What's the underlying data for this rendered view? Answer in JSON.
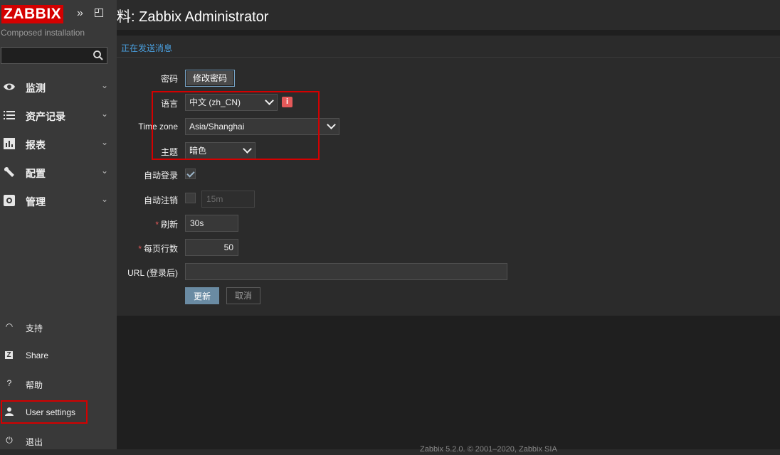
{
  "sidebar": {
    "logo": "ZABBIX",
    "installation": "Composed installation",
    "search": {
      "value": ""
    },
    "menu": [
      {
        "label": "监测",
        "icon": "eye-icon"
      },
      {
        "label": "资产记录",
        "icon": "list-icon"
      },
      {
        "label": "报表",
        "icon": "bar-chart-icon"
      },
      {
        "label": "配置",
        "icon": "wrench-icon"
      },
      {
        "label": "管理",
        "icon": "gear-icon"
      }
    ],
    "bottom": [
      {
        "label": "支持",
        "icon": "headset-icon"
      },
      {
        "label": "Share",
        "icon": "share-icon"
      },
      {
        "label": "帮助",
        "icon": "help-icon"
      },
      {
        "label": "User settings",
        "icon": "user-icon"
      },
      {
        "label": "退出",
        "icon": "power-icon"
      }
    ]
  },
  "header": {
    "title": "料: Zabbix Administrator"
  },
  "message_link": "正在发送消息",
  "form": {
    "password": {
      "label": "密码",
      "button": "修改密码"
    },
    "language": {
      "label": "语言",
      "value": "中文 (zh_CN)"
    },
    "timezone": {
      "label": "Time zone",
      "value": "Asia/Shanghai"
    },
    "theme": {
      "label": "主题",
      "value": "暗色"
    },
    "autologin": {
      "label": "自动登录",
      "checked": true
    },
    "autologout": {
      "label": "自动注销",
      "checked": false,
      "value": "15m"
    },
    "refresh": {
      "label": "刷新",
      "value": "30s"
    },
    "rows_per_page": {
      "label": "每页行数",
      "value": "50"
    },
    "url": {
      "label": "URL (登录后)",
      "value": ""
    },
    "buttons": {
      "update": "更新",
      "cancel": "取消"
    }
  },
  "footer": "Zabbix 5.2.0. © 2001–2020, Zabbix SIA",
  "colors": {
    "brand": "#d40000",
    "link": "#4aa0e0",
    "highlight": "#d40000"
  }
}
